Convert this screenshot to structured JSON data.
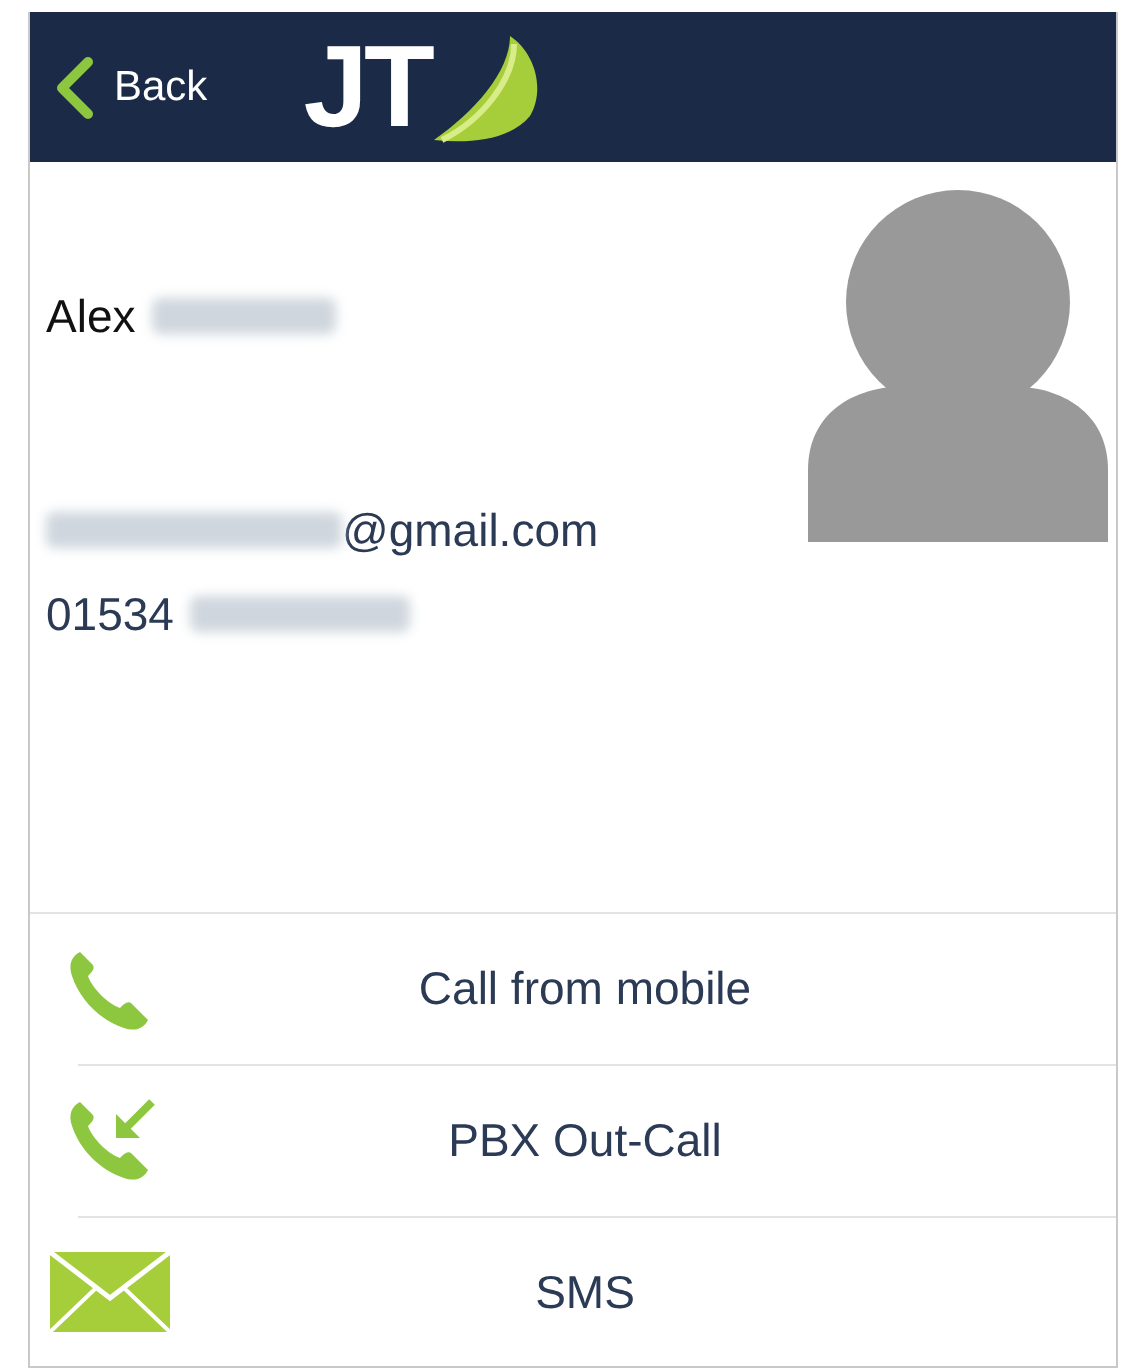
{
  "header": {
    "back_label": "Back",
    "logo_text": "JT"
  },
  "contact": {
    "first_name": "Alex",
    "email_domain": "@gmail.com",
    "phone_prefix": "01534"
  },
  "actions": [
    {
      "kind": "call",
      "label": "Call from mobile"
    },
    {
      "kind": "pbx",
      "label": "PBX Out-Call"
    },
    {
      "kind": "sms",
      "label": "SMS"
    }
  ]
}
